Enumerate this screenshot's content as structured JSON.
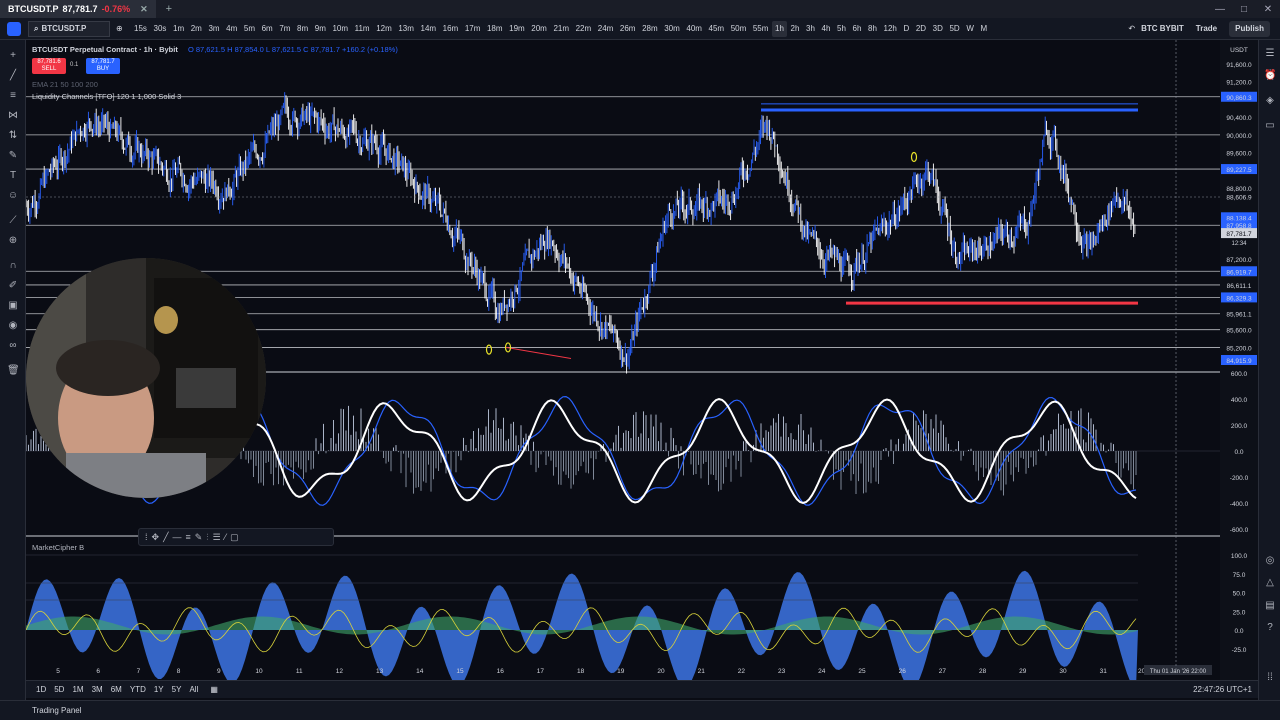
{
  "window": {
    "tab": {
      "symbol": "BTCUSDT.P",
      "price": "87,781.7",
      "change": "-0.76%"
    },
    "controls": [
      "—",
      "□",
      "✕"
    ]
  },
  "toolbar": {
    "symbol": "BTCUSDT.P",
    "timeframes": [
      "15s",
      "30s",
      "1m",
      "2m",
      "3m",
      "4m",
      "5m",
      "6m",
      "7m",
      "8m",
      "9m",
      "10m",
      "11m",
      "12m",
      "13m",
      "14m",
      "16m",
      "17m",
      "18m",
      "19m",
      "20m",
      "21m",
      "22m",
      "24m",
      "26m",
      "28m",
      "30m",
      "40m",
      "45m",
      "50m",
      "55m",
      "1h",
      "2h",
      "3h",
      "4h",
      "5h",
      "6h",
      "8h",
      "12h",
      "D",
      "2D",
      "3D",
      "5D",
      "W",
      "M"
    ],
    "active_timeframe": "1h",
    "broker": "BTC BYBIT",
    "trade": "Trade",
    "publish": "Publish"
  },
  "legend": {
    "title": "BTCUSDT Perpetual Contract · 1h · Bybit",
    "ohlc": "O 87,621.5  H 87,854.0  L 87,621.5  C 87,781.7  +160.2 (+0.18%)",
    "sell_price": "87,781.6",
    "sell_label": "SELL",
    "spread": "0.1",
    "buy_price": "87,781.7",
    "buy_label": "BUY",
    "indicator1": "EMA 21 50 100 200",
    "indicator2": "Liquidity Channels [TFO] 120 1 1,000 Solid 3",
    "pane3_title": "MarketCipher B"
  },
  "price_axis": {
    "currency": "USDT",
    "labels": [
      "91,600.0",
      "91,200.0",
      "90,860.3",
      "90,400.0",
      "90,000.0",
      "89,600.0",
      "89,227.5",
      "88,800.0",
      "88,606.9",
      "88,138.4",
      "87,958.8",
      "87,781.7",
      "87,200.0",
      "86,919.7",
      "86,611.1",
      "86,329.3",
      "85,961.1",
      "85,600.0",
      "85,200.0",
      "84,915.9"
    ],
    "current": "87,781.7",
    "countdown": "12:34",
    "osc_labels": [
      "600.0",
      "400.0",
      "200.0",
      "0.0",
      "-200.0",
      "-400.0",
      "-600.0"
    ],
    "mcb_labels": [
      "100.0",
      "75.0",
      "50.0",
      "25.0",
      "0.0",
      "-25.0"
    ]
  },
  "time_axis": {
    "labels": [
      "5",
      "6",
      "7",
      "8",
      "9",
      "10",
      "11",
      "12",
      "13",
      "14",
      "15",
      "16",
      "17",
      "18",
      "19",
      "20",
      "21",
      "22",
      "23",
      "24",
      "25",
      "26",
      "27",
      "28",
      "29",
      "30",
      "31",
      "202"
    ],
    "crosshair": "Thu 01 Jan '26   22:00"
  },
  "bottom": {
    "ranges": [
      "1D",
      "5D",
      "1M",
      "3M",
      "6M",
      "YTD",
      "1Y",
      "5Y",
      "All"
    ],
    "clock": "22:47:26 UTC+1",
    "trading_panel": "Trading Panel"
  },
  "colors": {
    "up": "#2962ff",
    "down": "#ffffff",
    "bg": "#0a0c14",
    "sell": "#f23645",
    "buy": "#2962ff",
    "pane": "#131722",
    "resistance": "#2962ff",
    "support": "#f23645",
    "marker": "#e8e229"
  }
}
